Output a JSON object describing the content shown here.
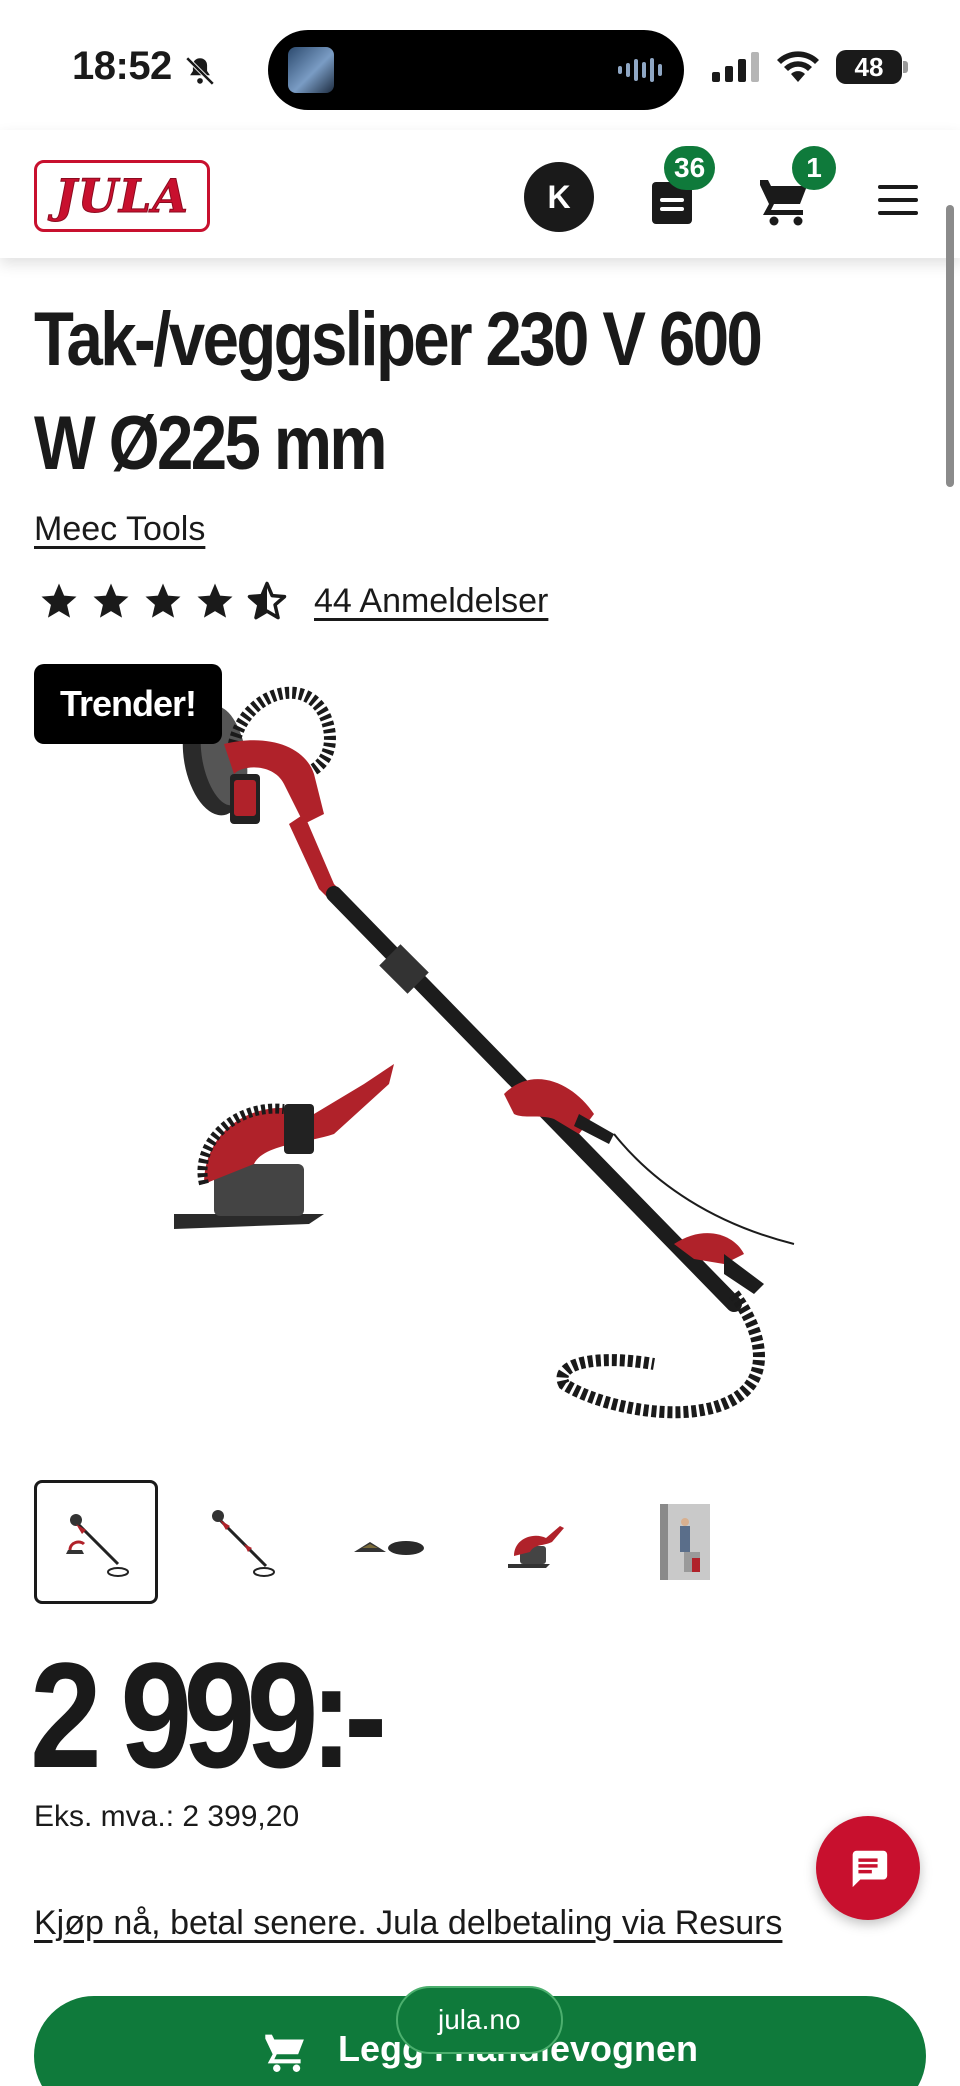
{
  "status_bar": {
    "time": "18:52",
    "battery": "48"
  },
  "header": {
    "logo_text": "JULA",
    "avatar_initial": "K",
    "list_count": "36",
    "cart_count": "1"
  },
  "product": {
    "title": "Tak-/veggsliper 230 V 600 W Ø225 mm",
    "brand": "Meec Tools",
    "rating": 4.5,
    "reviews_label": "44 Anmeldelser",
    "badge": "Trender!",
    "thumbnail_count": 5,
    "active_thumbnail": 1,
    "price": "2 999:-",
    "ex_vat": "Eks. mva.: 2 399,20",
    "financing_link": "Kjøp nå, betal senere. Jula delbetaling via Resurs",
    "add_to_cart_label": "Legg i handlevognen"
  },
  "browser": {
    "url": "jula.no"
  },
  "colors": {
    "brand_red": "#c8102e",
    "accent_green": "#0f7a3b"
  }
}
